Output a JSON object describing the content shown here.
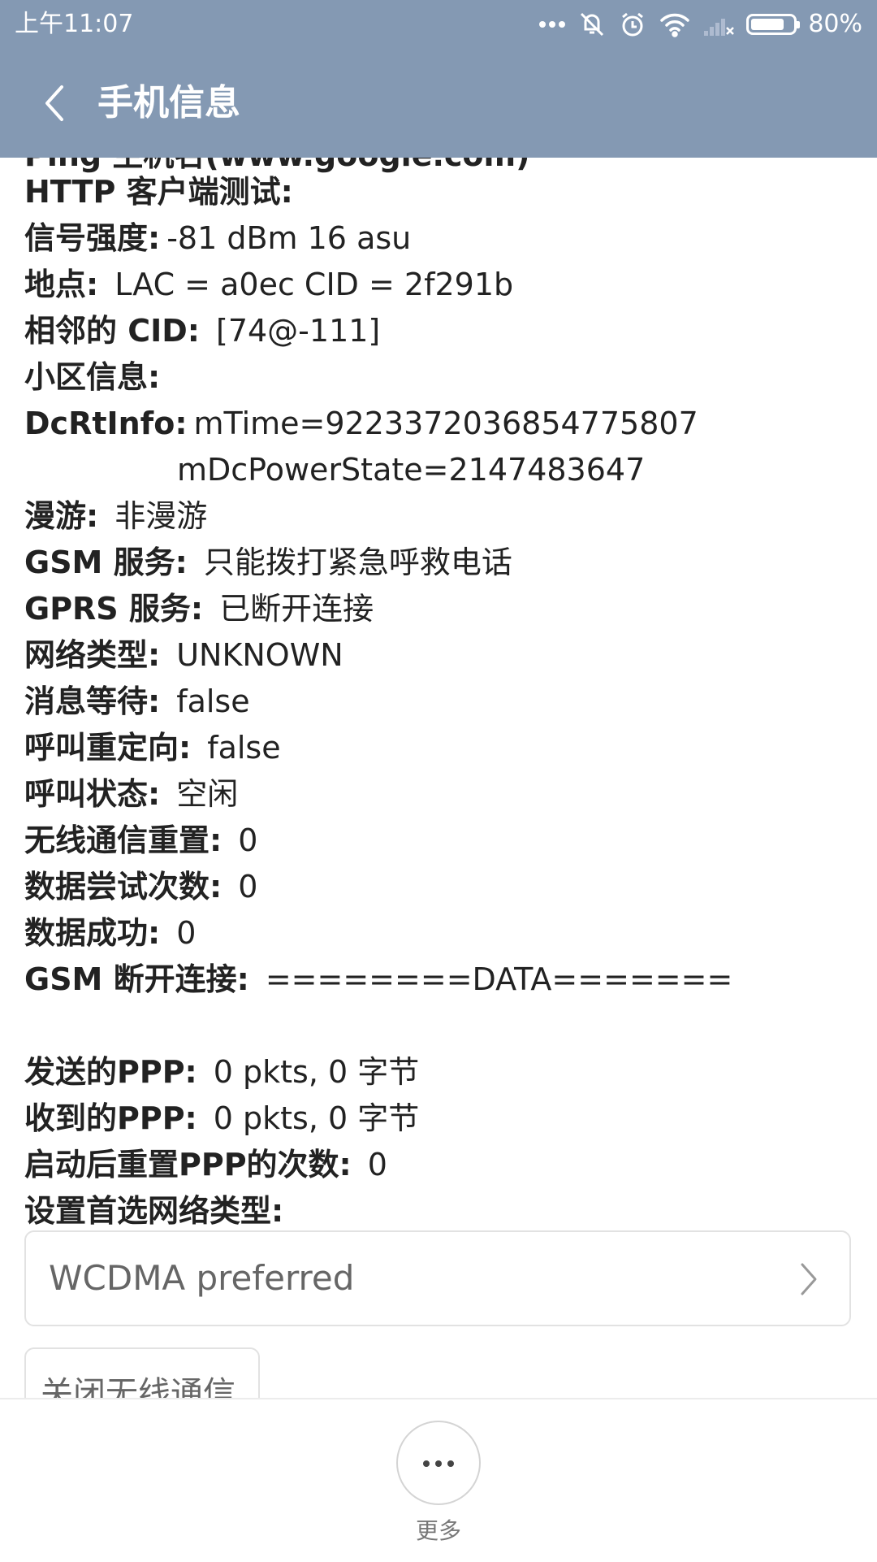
{
  "status_bar": {
    "time": "上午11:07",
    "battery_percent": "80%",
    "battery_level": 0.8
  },
  "header": {
    "title": "手机信息"
  },
  "content": {
    "cut_off_text": "Ping 主机名(www.google.com)",
    "rows": [
      {
        "label": "HTTP 客户端测试:",
        "value": ""
      },
      {
        "label": "信号强度:",
        "value": "-81 dBm   16 asu"
      },
      {
        "label": "地点:",
        "value": "LAC = a0ec   CID = 2f291b"
      },
      {
        "label": "相邻的 CID:",
        "value": "[74@-111]"
      },
      {
        "label": "小区信息:",
        "value": ""
      },
      {
        "label": "DcRtInfo:",
        "value": "mTime=9223372036854775807"
      },
      {
        "label": "",
        "value": "mDcPowerState=2147483647"
      },
      {
        "label": "漫游:",
        "value": "非漫游"
      },
      {
        "label": "GSM 服务:",
        "value": "只能拨打紧急呼救电话"
      },
      {
        "label": "GPRS 服务:",
        "value": "已断开连接"
      },
      {
        "label": "网络类型:",
        "value": "UNKNOWN"
      },
      {
        "label": "消息等待:",
        "value": "false"
      },
      {
        "label": "呼叫重定向:",
        "value": "false"
      },
      {
        "label": "呼叫状态:",
        "value": "空闲"
      },
      {
        "label": "无线通信重置:",
        "value": "0"
      },
      {
        "label": "数据尝试次数:",
        "value": "0"
      },
      {
        "label": "数据成功:",
        "value": "0"
      },
      {
        "label": "GSM 断开连接:",
        "value": "========DATA======="
      },
      {
        "label": "发送的PPP:",
        "value": "0 pkts, 0 字节"
      },
      {
        "label": "收到的PPP:",
        "value": "0 pkts, 0 字节"
      },
      {
        "label": "启动后重置PPP的次数:",
        "value": "0"
      },
      {
        "label": "设置首选网络类型:",
        "value": ""
      }
    ],
    "preferred_network_value": "WCDMA preferred",
    "radio_button_label": "关闭无线通信"
  },
  "bottom_bar": {
    "more_label": "更多"
  }
}
